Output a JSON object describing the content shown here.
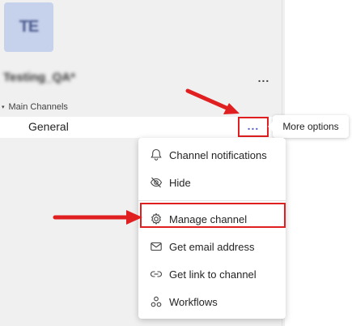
{
  "team": {
    "avatar_initials": "TE",
    "name": "Testing_QA*",
    "more_label": "..."
  },
  "section": {
    "caret": "▾",
    "label": "Main Channels"
  },
  "channel": {
    "name": "General",
    "more_label": "..."
  },
  "tooltip": {
    "text": "More options"
  },
  "menu": {
    "items": [
      {
        "label": "Channel notifications",
        "icon": "bell-icon"
      },
      {
        "label": "Hide",
        "icon": "hide-icon"
      },
      {
        "label": "Manage channel",
        "icon": "gear-icon"
      },
      {
        "label": "Get email address",
        "icon": "mail-icon"
      },
      {
        "label": "Get link to channel",
        "icon": "link-icon"
      },
      {
        "label": "Workflows",
        "icon": "workflows-icon"
      }
    ]
  },
  "colors": {
    "accent": "#5b5fc7",
    "annotation": "#e02020",
    "avatar_bg": "#c6d1ec"
  }
}
